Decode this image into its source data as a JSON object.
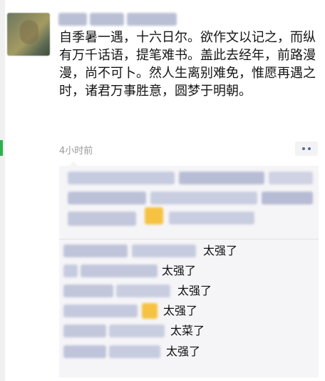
{
  "post": {
    "text": "自季暑一遇，十六日尔。欲作文以记之，而纵有万千话语，提笔难书。盖此去经年，前路漫漫，尚不可卜。然人生离别难免，惟愿再遇之时，诸君万事胜意，圆梦于明朝。",
    "time": "4小时前"
  },
  "comments": [
    {
      "text": "太强了",
      "emoji": false
    },
    {
      "text": "太强了",
      "emoji": false
    },
    {
      "text": "太强了",
      "emoji": false
    },
    {
      "text": "太强了",
      "emoji": true
    },
    {
      "text": "太菜了",
      "emoji": false
    },
    {
      "text": "太强了",
      "emoji": false
    }
  ],
  "colors": {
    "link_blue": "#576b95",
    "panel_bg": "#f5f5f7",
    "time_gray": "#9a9a9a",
    "emoji_yellow": "#f5c242"
  },
  "icons": {
    "more": "more-dots-icon"
  }
}
